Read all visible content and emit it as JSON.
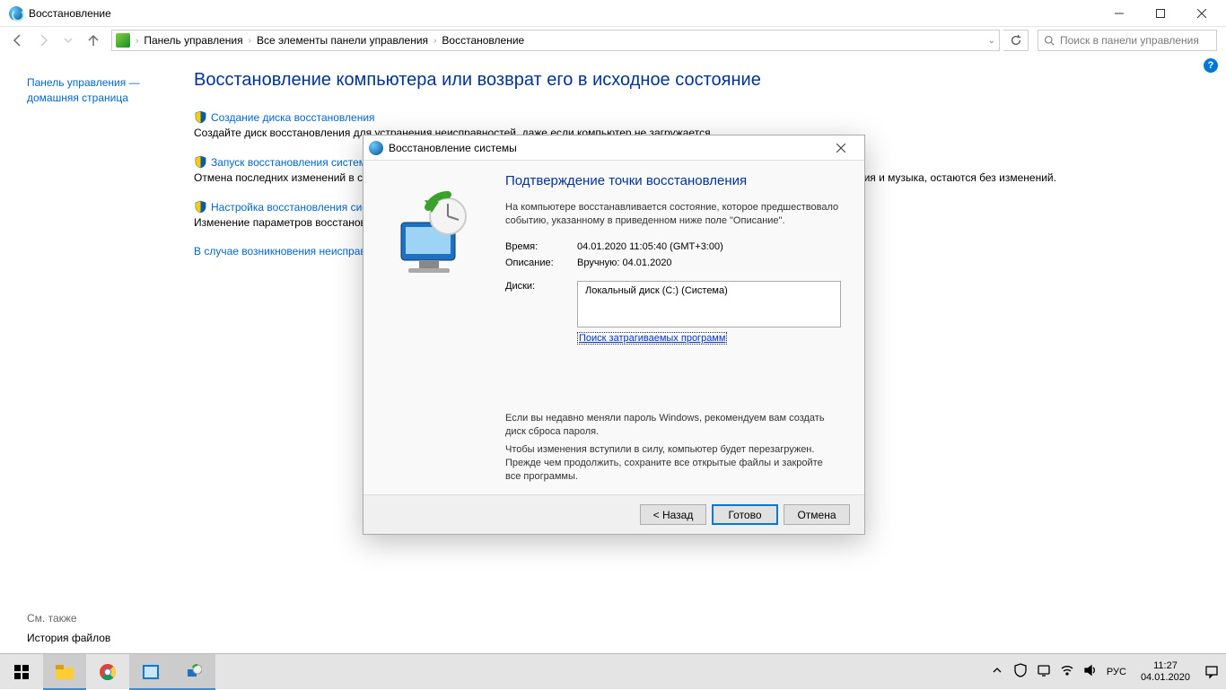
{
  "window": {
    "title": "Восстановление"
  },
  "breadcrumbs": {
    "root": "Панель управления",
    "level2": "Все элементы панели управления",
    "current": "Восстановление"
  },
  "search": {
    "placeholder": "Поиск в панели управления"
  },
  "sidebar": {
    "home_line1": "Панель управления —",
    "home_line2": "домашняя страница",
    "see_also_label": "См. также",
    "history_link": "История файлов"
  },
  "page": {
    "heading": "Восстановление компьютера или возврат его в исходное состояние",
    "tasks": [
      {
        "link": "Создание диска восстановления",
        "desc": "Создайте диск восстановления для устранения неисправностей, даже если компьютер не загружается."
      },
      {
        "link": "Запуск восстановления системы",
        "desc": "Отмена последних изменений в системе, которые могли вызвать проблемы. При этом ваши файлы, такие как документы, изображения и музыка, остаются без изменений."
      },
      {
        "link": "Настройка восстановления системы",
        "desc": "Изменение параметров восстановления, управление дисковым пространством и удаление или создание точек восстановления."
      }
    ],
    "troubleshoot": "В случае возникновения неисправностей на компьютере перейдите к его параметрам и попробуйте изменить их."
  },
  "dialog": {
    "title": "Восстановление системы",
    "heading": "Подтверждение точки восстановления",
    "intro": "На компьютере восстанавливается состояние, которое предшествовало событию, указанному в приведенном ниже поле \"Описание\".",
    "time_label": "Время:",
    "time_value": "04.01.2020 11:05:40 (GMT+3:00)",
    "desc_label": "Описание:",
    "desc_value": "Вручную: 04.01.2020",
    "disks_label": "Диски:",
    "disks_value": "Локальный диск (C:) (Система)",
    "affected_link": "Поиск затрагиваемых программ",
    "password_warn": "Если вы недавно меняли пароль Windows, рекомендуем вам создать диск сброса пароля.",
    "restart_warn": "Чтобы изменения вступили в силу, компьютер будет перезагружен. Прежде чем продолжить, сохраните все открытые файлы и закройте все программы.",
    "back_btn": "< Назад",
    "finish_btn": "Готово",
    "cancel_btn": "Отмена"
  },
  "tray": {
    "lang": "РУС",
    "time": "11:27",
    "date": "04.01.2020"
  }
}
